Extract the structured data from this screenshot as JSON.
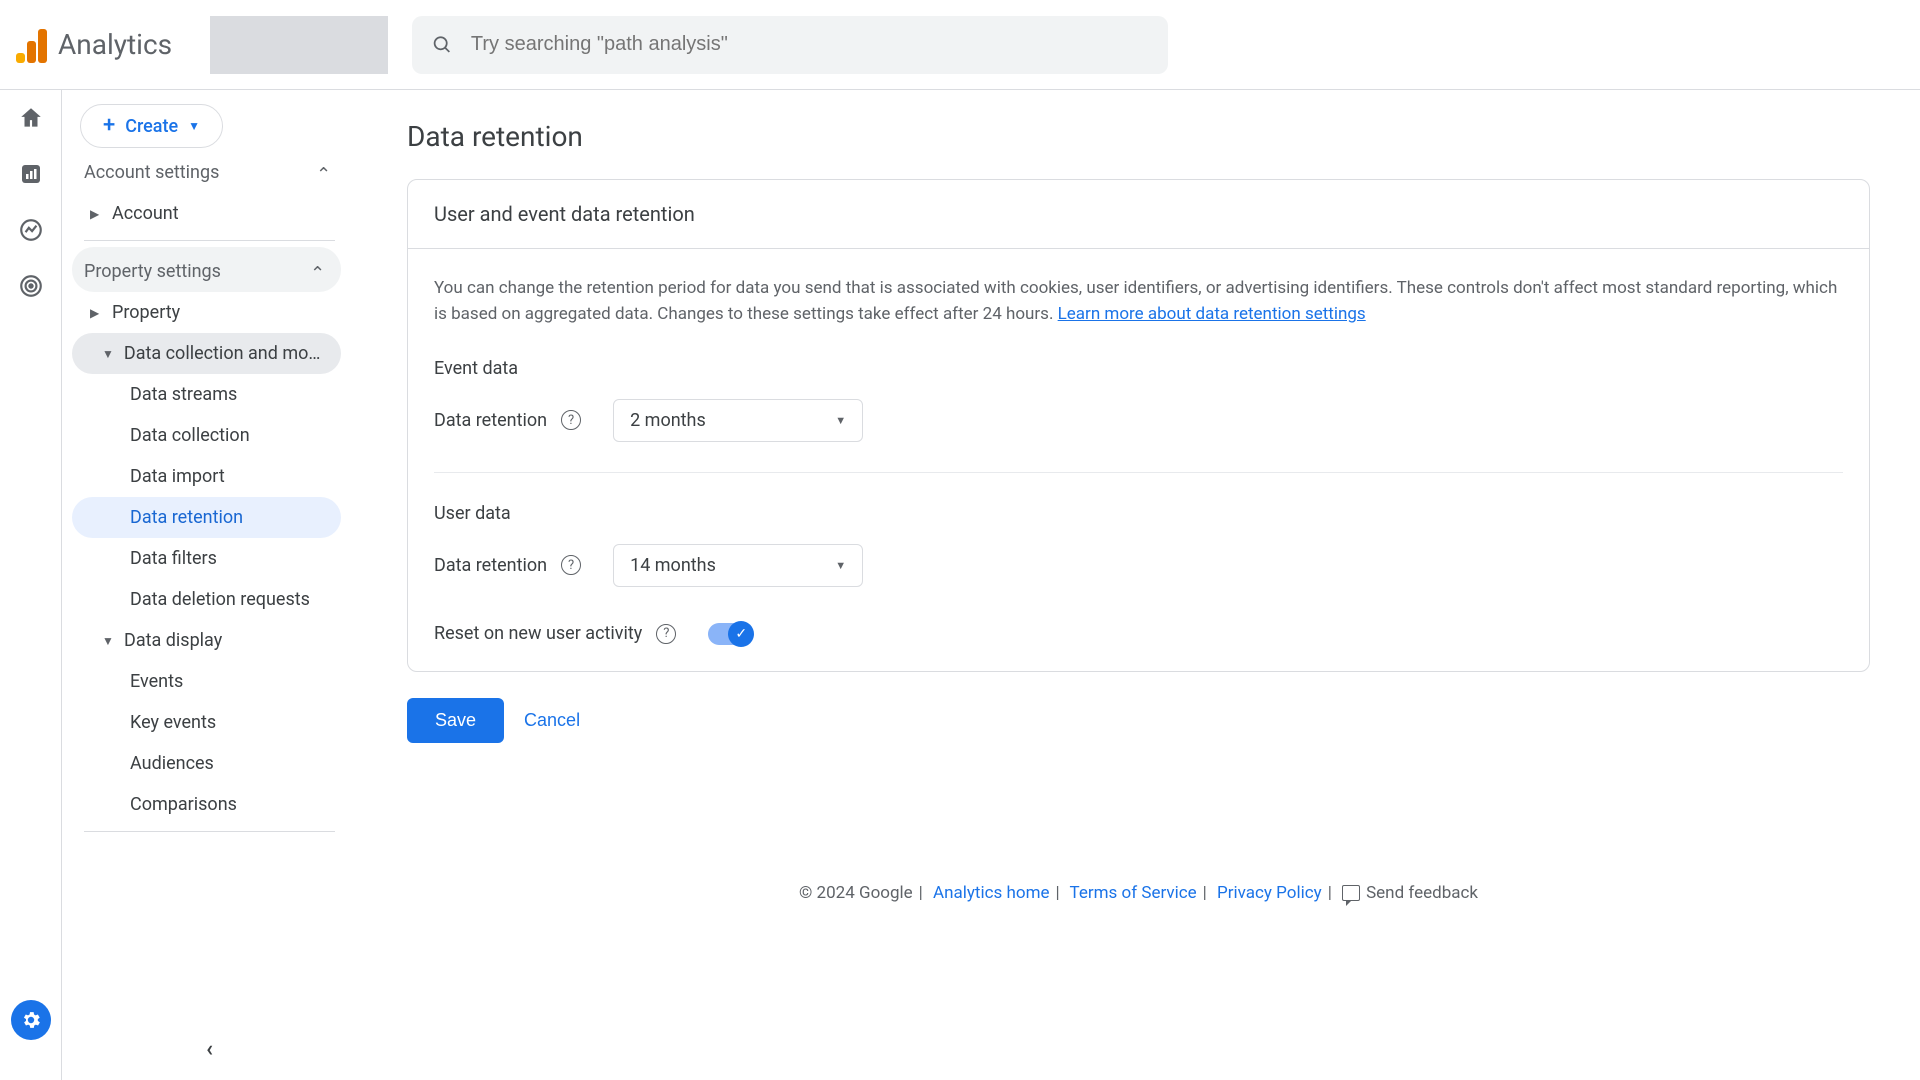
{
  "header": {
    "product": "Analytics",
    "search_placeholder": "Try searching \"path analysis\""
  },
  "sidebar": {
    "create_label": "Create",
    "account_settings_label": "Account settings",
    "account_label": "Account",
    "property_settings_label": "Property settings",
    "property_label": "Property",
    "data_collection_group": "Data collection and modifica...",
    "items_dc": [
      "Data streams",
      "Data collection",
      "Data import",
      "Data retention",
      "Data filters",
      "Data deletion requests"
    ],
    "data_display_label": "Data display",
    "items_dd": [
      "Events",
      "Key events",
      "Audiences",
      "Comparisons"
    ]
  },
  "main": {
    "title": "Data retention",
    "card_title": "User and event data retention",
    "description": "You can change the retention period for data you send that is associated with cookies, user identifiers, or advertising identifiers. These controls don't affect most standard reporting, which is based on aggregated data. Changes to these settings take effect after 24 hours. ",
    "learn_more": "Learn more about data retention settings",
    "event_section": "Event data",
    "user_section": "User data",
    "retention_label": "Data retention",
    "event_value": "2 months",
    "user_value": "14 months",
    "reset_label": "Reset on new user activity",
    "save": "Save",
    "cancel": "Cancel"
  },
  "footer": {
    "copyright": "© 2024 Google",
    "analytics_home": "Analytics home",
    "tos": "Terms of Service",
    "privacy": "Privacy Policy",
    "feedback": "Send feedback"
  }
}
